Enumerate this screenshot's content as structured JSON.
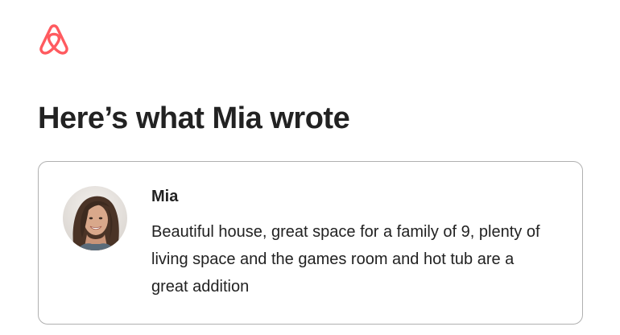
{
  "brand": {
    "logo_icon": "airbnb-logo-icon",
    "accent_color": "#ff5a5f"
  },
  "headline": "Here’s what Mia wrote",
  "review": {
    "reviewer_name": "Mia",
    "avatar_icon": "reviewer-avatar",
    "text": "Beautiful house, great space for a family of 9, plenty of living space and the games room and hot tub are a great addition"
  }
}
